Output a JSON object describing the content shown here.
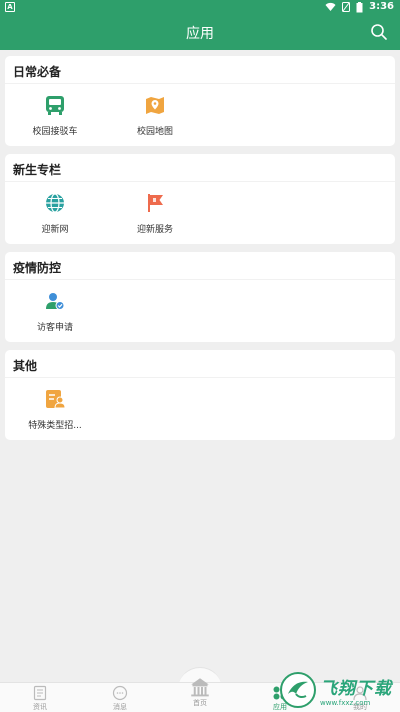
{
  "statusbar": {
    "time": "3:36",
    "left_badge": "A"
  },
  "appbar": {
    "title": "应用"
  },
  "sections": [
    {
      "title": "日常必备",
      "items": [
        {
          "label": "校园接驳车",
          "icon": "bus-icon"
        },
        {
          "label": "校园地图",
          "icon": "map-icon"
        }
      ]
    },
    {
      "title": "新生专栏",
      "items": [
        {
          "label": "迎新网",
          "icon": "globe-icon"
        },
        {
          "label": "迎新服务",
          "icon": "flag-icon"
        }
      ]
    },
    {
      "title": "疫情防控",
      "items": [
        {
          "label": "访客申请",
          "icon": "visitor-icon"
        }
      ]
    },
    {
      "title": "其他",
      "items": [
        {
          "label": "特殊类型招...",
          "icon": "special-admission-icon"
        }
      ]
    }
  ],
  "tabbar": {
    "tabs": [
      {
        "label": "资讯",
        "icon": "news-icon"
      },
      {
        "label": "消息",
        "icon": "message-icon"
      },
      {
        "label": "首页",
        "icon": "home-icon"
      },
      {
        "label": "应用",
        "icon": "apps-icon",
        "active": true
      },
      {
        "label": "我的",
        "icon": "profile-icon"
      }
    ]
  },
  "watermark": {
    "text": "飞翔下载",
    "url": "www.fxxz.com"
  },
  "colors": {
    "primary": "#2e9f6b",
    "orange": "#f0a540",
    "teal": "#2aa1a0",
    "red": "#ee6b4d",
    "blue": "#3f8fd8",
    "background": "#efefef"
  }
}
